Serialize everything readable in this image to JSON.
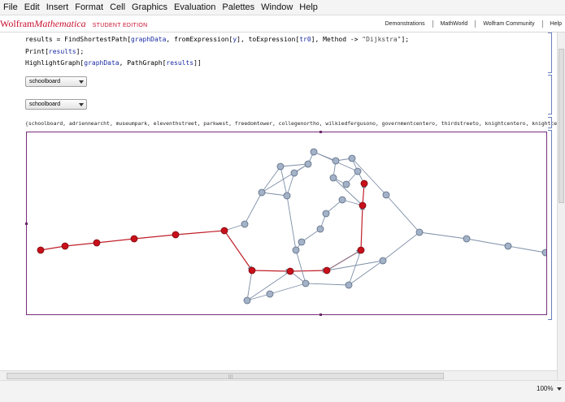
{
  "menu": [
    "File",
    "Edit",
    "Insert",
    "Format",
    "Cell",
    "Graphics",
    "Evaluation",
    "Palettes",
    "Window",
    "Help"
  ],
  "brand": {
    "wolfram": "Wolfram",
    "mathematica": "Mathematica",
    "edition": "STUDENT EDITION"
  },
  "links": [
    "Demonstrations",
    "MathWorld",
    "Wolfram Community",
    "Help"
  ],
  "code": {
    "line1_a": "results = FindShortestPath[",
    "line1_b": "graphData",
    "line1_c": ", ",
    "line1_d": "fromExpression",
    "line1_e": "[",
    "line1_f": "y",
    "line1_g": "], ",
    "line1_h": "toExpression",
    "line1_i": "[",
    "line1_j": "tr0",
    "line1_k": "], Method -> ",
    "line1_l": "\"Dijkstra\"",
    "line1_m": "];",
    "line2_a": "Print[",
    "line2_b": "results",
    "line2_c": "];",
    "line3_a": "HighlightGraph[",
    "line3_b": "graphData",
    "line3_c": ", PathGraph[",
    "line3_d": "results",
    "line3_e": "]]"
  },
  "popups": [
    "schoolboard",
    "schoolboard"
  ],
  "output_list": "{schoolboard, adriennearcht, museumpark, eleventhstreet, parkwest, freedomtower, collegenortho, wilkiedfergusono, governmentcentero, thirdstreeto, knightcentero, knightcenteri}",
  "zoom": "100%",
  "colors": {
    "path_node": "#c8101a",
    "path_edge": "#c0202a",
    "node": "#a3b2c6",
    "node_stroke": "#5d6e87",
    "edge": "#7d8ea6"
  }
}
